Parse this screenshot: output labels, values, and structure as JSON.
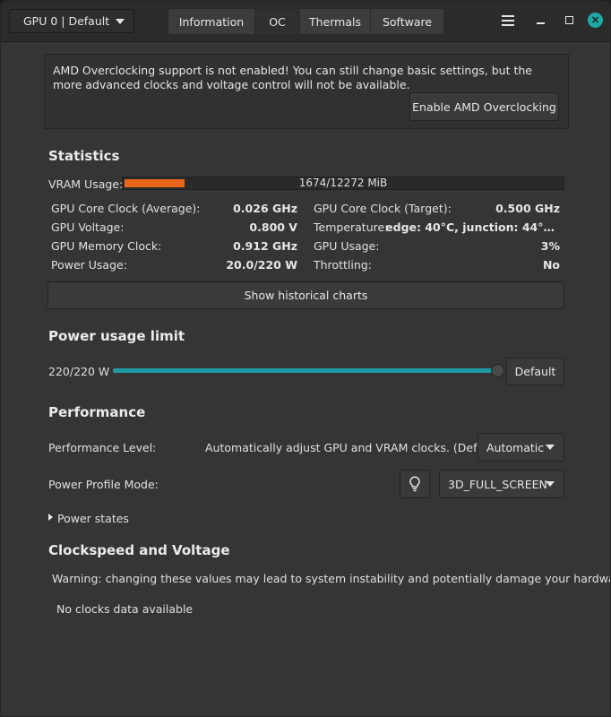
{
  "header": {
    "gpu_select": "GPU 0 | Default",
    "tabs": [
      "Information",
      "OC",
      "Thermals",
      "Software"
    ],
    "active_tab": "OC"
  },
  "notice": {
    "text": "AMD Overclocking support is not enabled! You can still change basic settings, but the more advanced clocks and voltage control will not be available.",
    "button": "Enable AMD Overclocking"
  },
  "statistics": {
    "title": "Statistics",
    "vram_label": "VRAM Usage:",
    "vram_text": "1674/12272 MiB",
    "vram_used": 1674,
    "vram_total": 12272,
    "left": [
      {
        "label": "GPU Core Clock (Average):",
        "value": "0.026 GHz"
      },
      {
        "label": "GPU Voltage:",
        "value": "0.800 V"
      },
      {
        "label": "GPU Memory Clock:",
        "value": "0.912 GHz"
      },
      {
        "label": "Power Usage:",
        "value": "20.0/220 W"
      }
    ],
    "right": [
      {
        "label": "GPU Core Clock (Target):",
        "value": "0.500 GHz"
      },
      {
        "label": "Temperature:",
        "value": "edge: 40°C, junction: 44°…"
      },
      {
        "label": "GPU Usage:",
        "value": "3%"
      },
      {
        "label": "Throttling:",
        "value": "No"
      }
    ],
    "history_button": "Show historical charts"
  },
  "power": {
    "title": "Power usage limit",
    "value_label": "220/220 W",
    "current": 220,
    "max": 220,
    "default_button": "Default"
  },
  "performance": {
    "title": "Performance",
    "level_label": "Performance Level:",
    "level_description": "Automatically adjust GPU and VRAM clocks. (Default)",
    "level_value": "Automatic",
    "profile_label": "Power Profile Mode:",
    "profile_value": "3D_FULL_SCREEN",
    "power_states": "Power states"
  },
  "clockspeed": {
    "title": "Clockspeed and Voltage",
    "warning": "Warning: changing these values may lead to system instability and potentially damage your hardware!",
    "empty": "No clocks data available"
  },
  "colors": {
    "accent": "#1f9aa5",
    "vram_fill": "#e8661c",
    "close_button": "#1fa7a5"
  }
}
